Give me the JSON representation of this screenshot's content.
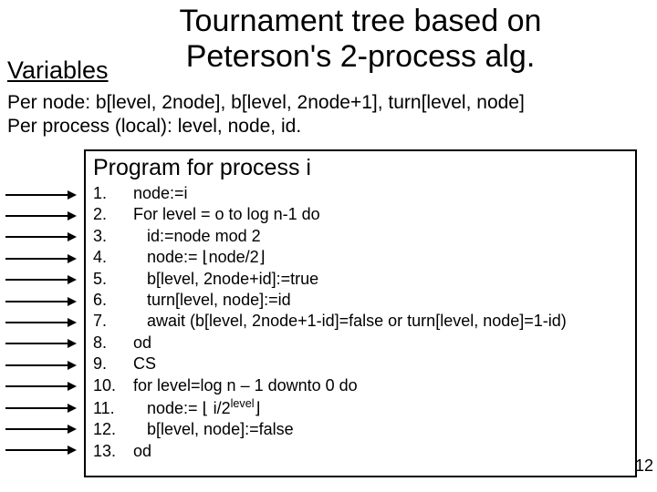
{
  "title_line1": "Tournament tree based on",
  "title_line2": "Peterson's 2-process alg.",
  "variables_heading": "Variables",
  "variables_line1": "Per node: b[level, 2node], b[level, 2node+1], turn[level, node]",
  "variables_line2": "Per process (local): level, node, id.",
  "program_heading": "Program for process i",
  "code": [
    {
      "n": "1.",
      "t": "node:=i"
    },
    {
      "n": "2.",
      "t": "For level = o to log n-1 do"
    },
    {
      "n": "3.",
      "t": "   id:=node mod 2"
    },
    {
      "n": "4.",
      "t": "   node:= ⌊node/2⌋"
    },
    {
      "n": "5.",
      "t": "   b[level, 2node+id]:=true"
    },
    {
      "n": "6.",
      "t": "   turn[level, node]:=id"
    },
    {
      "n": "7.",
      "t": "   await (b[level, 2node+1-id]=false or turn[level, node]=1-id)"
    },
    {
      "n": "8.",
      "t": "od"
    },
    {
      "n": "9.",
      "t": "CS"
    },
    {
      "n": "10.",
      "t": "for level=log n – 1 downto 0 do"
    },
    {
      "n": "11.",
      "t_html": "   node:= ⌊ i/2<sup>level</sup>⌋"
    },
    {
      "n": "12.",
      "t": "   b[level, node]:=false"
    },
    {
      "n": "13.",
      "t": "od"
    }
  ],
  "page_number": "12"
}
